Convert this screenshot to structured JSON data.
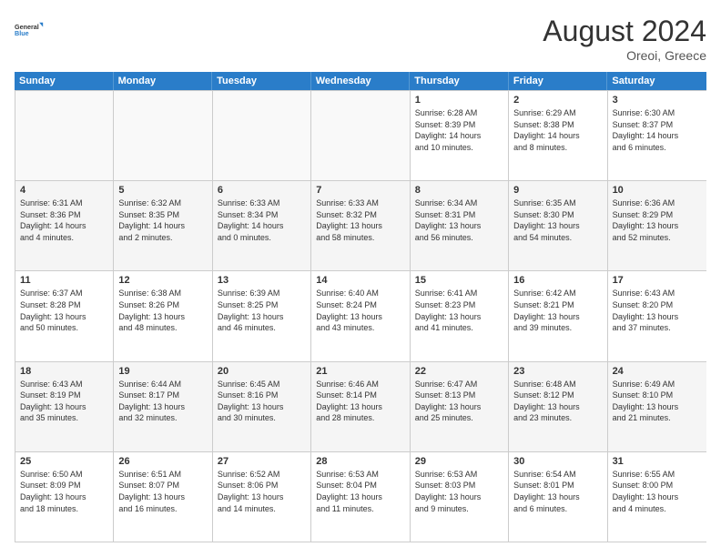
{
  "header": {
    "logo_general": "General",
    "logo_blue": "Blue",
    "month_year": "August 2024",
    "location": "Oreoi, Greece"
  },
  "days_of_week": [
    "Sunday",
    "Monday",
    "Tuesday",
    "Wednesday",
    "Thursday",
    "Friday",
    "Saturday"
  ],
  "weeks": [
    [
      {
        "day": "",
        "info": ""
      },
      {
        "day": "",
        "info": ""
      },
      {
        "day": "",
        "info": ""
      },
      {
        "day": "",
        "info": ""
      },
      {
        "day": "1",
        "info": "Sunrise: 6:28 AM\nSunset: 8:39 PM\nDaylight: 14 hours\nand 10 minutes."
      },
      {
        "day": "2",
        "info": "Sunrise: 6:29 AM\nSunset: 8:38 PM\nDaylight: 14 hours\nand 8 minutes."
      },
      {
        "day": "3",
        "info": "Sunrise: 6:30 AM\nSunset: 8:37 PM\nDaylight: 14 hours\nand 6 minutes."
      }
    ],
    [
      {
        "day": "4",
        "info": "Sunrise: 6:31 AM\nSunset: 8:36 PM\nDaylight: 14 hours\nand 4 minutes."
      },
      {
        "day": "5",
        "info": "Sunrise: 6:32 AM\nSunset: 8:35 PM\nDaylight: 14 hours\nand 2 minutes."
      },
      {
        "day": "6",
        "info": "Sunrise: 6:33 AM\nSunset: 8:34 PM\nDaylight: 14 hours\nand 0 minutes."
      },
      {
        "day": "7",
        "info": "Sunrise: 6:33 AM\nSunset: 8:32 PM\nDaylight: 13 hours\nand 58 minutes."
      },
      {
        "day": "8",
        "info": "Sunrise: 6:34 AM\nSunset: 8:31 PM\nDaylight: 13 hours\nand 56 minutes."
      },
      {
        "day": "9",
        "info": "Sunrise: 6:35 AM\nSunset: 8:30 PM\nDaylight: 13 hours\nand 54 minutes."
      },
      {
        "day": "10",
        "info": "Sunrise: 6:36 AM\nSunset: 8:29 PM\nDaylight: 13 hours\nand 52 minutes."
      }
    ],
    [
      {
        "day": "11",
        "info": "Sunrise: 6:37 AM\nSunset: 8:28 PM\nDaylight: 13 hours\nand 50 minutes."
      },
      {
        "day": "12",
        "info": "Sunrise: 6:38 AM\nSunset: 8:26 PM\nDaylight: 13 hours\nand 48 minutes."
      },
      {
        "day": "13",
        "info": "Sunrise: 6:39 AM\nSunset: 8:25 PM\nDaylight: 13 hours\nand 46 minutes."
      },
      {
        "day": "14",
        "info": "Sunrise: 6:40 AM\nSunset: 8:24 PM\nDaylight: 13 hours\nand 43 minutes."
      },
      {
        "day": "15",
        "info": "Sunrise: 6:41 AM\nSunset: 8:23 PM\nDaylight: 13 hours\nand 41 minutes."
      },
      {
        "day": "16",
        "info": "Sunrise: 6:42 AM\nSunset: 8:21 PM\nDaylight: 13 hours\nand 39 minutes."
      },
      {
        "day": "17",
        "info": "Sunrise: 6:43 AM\nSunset: 8:20 PM\nDaylight: 13 hours\nand 37 minutes."
      }
    ],
    [
      {
        "day": "18",
        "info": "Sunrise: 6:43 AM\nSunset: 8:19 PM\nDaylight: 13 hours\nand 35 minutes."
      },
      {
        "day": "19",
        "info": "Sunrise: 6:44 AM\nSunset: 8:17 PM\nDaylight: 13 hours\nand 32 minutes."
      },
      {
        "day": "20",
        "info": "Sunrise: 6:45 AM\nSunset: 8:16 PM\nDaylight: 13 hours\nand 30 minutes."
      },
      {
        "day": "21",
        "info": "Sunrise: 6:46 AM\nSunset: 8:14 PM\nDaylight: 13 hours\nand 28 minutes."
      },
      {
        "day": "22",
        "info": "Sunrise: 6:47 AM\nSunset: 8:13 PM\nDaylight: 13 hours\nand 25 minutes."
      },
      {
        "day": "23",
        "info": "Sunrise: 6:48 AM\nSunset: 8:12 PM\nDaylight: 13 hours\nand 23 minutes."
      },
      {
        "day": "24",
        "info": "Sunrise: 6:49 AM\nSunset: 8:10 PM\nDaylight: 13 hours\nand 21 minutes."
      }
    ],
    [
      {
        "day": "25",
        "info": "Sunrise: 6:50 AM\nSunset: 8:09 PM\nDaylight: 13 hours\nand 18 minutes."
      },
      {
        "day": "26",
        "info": "Sunrise: 6:51 AM\nSunset: 8:07 PM\nDaylight: 13 hours\nand 16 minutes."
      },
      {
        "day": "27",
        "info": "Sunrise: 6:52 AM\nSunset: 8:06 PM\nDaylight: 13 hours\nand 14 minutes."
      },
      {
        "day": "28",
        "info": "Sunrise: 6:53 AM\nSunset: 8:04 PM\nDaylight: 13 hours\nand 11 minutes."
      },
      {
        "day": "29",
        "info": "Sunrise: 6:53 AM\nSunset: 8:03 PM\nDaylight: 13 hours\nand 9 minutes."
      },
      {
        "day": "30",
        "info": "Sunrise: 6:54 AM\nSunset: 8:01 PM\nDaylight: 13 hours\nand 6 minutes."
      },
      {
        "day": "31",
        "info": "Sunrise: 6:55 AM\nSunset: 8:00 PM\nDaylight: 13 hours\nand 4 minutes."
      }
    ]
  ]
}
